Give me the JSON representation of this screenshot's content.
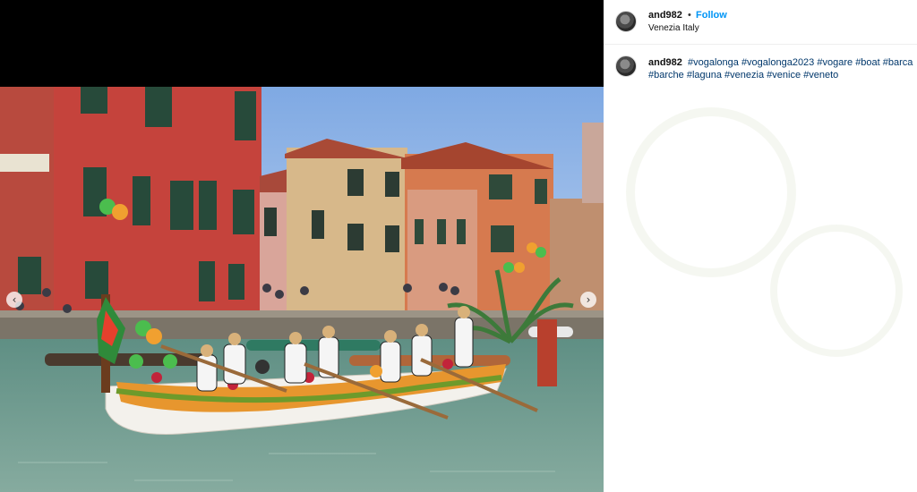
{
  "post": {
    "username": "and982",
    "separator": "•",
    "follow_label": "Follow",
    "location": "Venezia Italy"
  },
  "caption": {
    "username": "and982",
    "hashtags": [
      "#vogalonga",
      "#vogalonga2023",
      "#vogare",
      "#boat",
      "#barca",
      "#barche",
      "#laguna",
      "#venezia",
      "#venice",
      "#veneto"
    ]
  },
  "media": {
    "prev_icon": "‹",
    "next_icon": "›"
  },
  "colors": {
    "follow": "#0095f6",
    "hashtag": "#00376b",
    "canal": "#6f9a8e",
    "sky": "#8fb6e6"
  }
}
